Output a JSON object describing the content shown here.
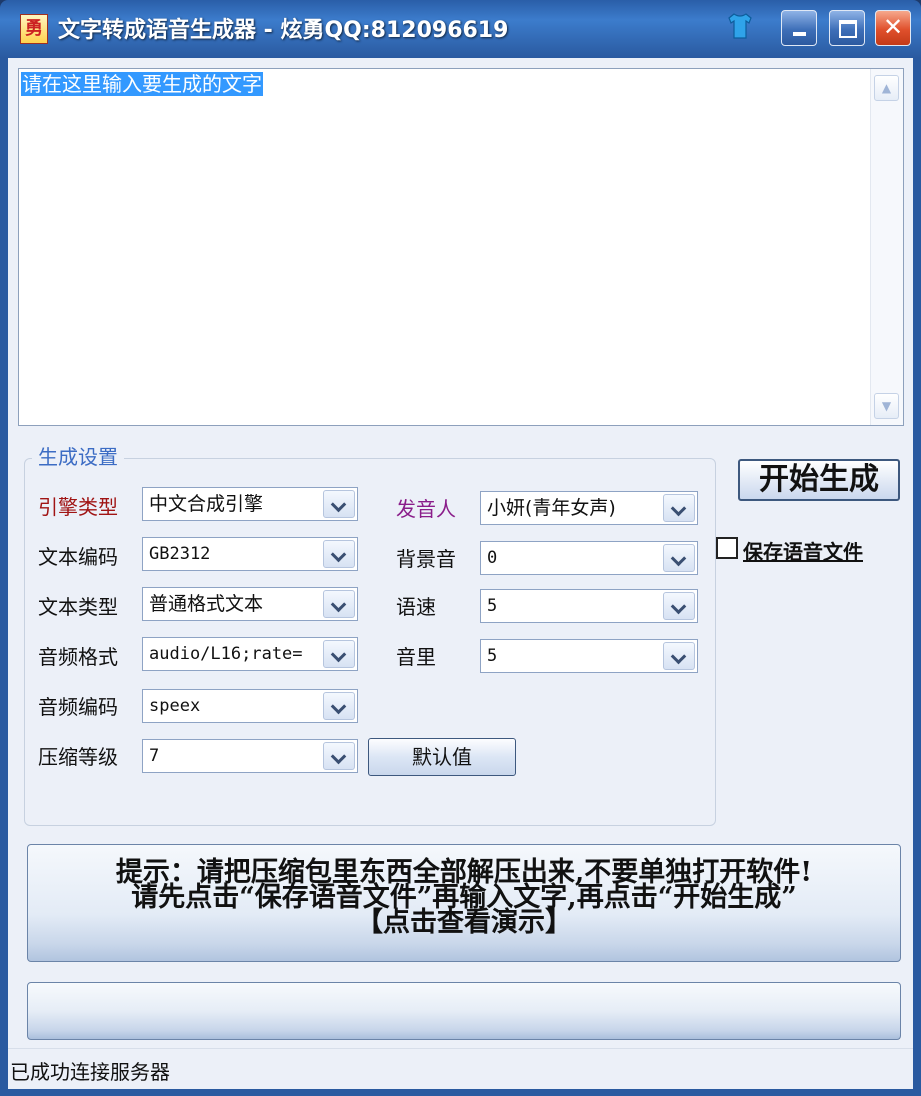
{
  "window": {
    "title": "文字转成语音生成器 - 炫勇QQ:812096619",
    "app_icon_char": "勇"
  },
  "input": {
    "text": "请在这里输入要生成的文字"
  },
  "settings": {
    "group_title": "生成设置",
    "engine": {
      "label": "引擎类型",
      "value": "中文合成引擎"
    },
    "encoding": {
      "label": "文本编码",
      "value": "GB2312"
    },
    "text_type": {
      "label": "文本类型",
      "value": "普通格式文本"
    },
    "audio_format": {
      "label": "音频格式",
      "value": "audio/L16;rate="
    },
    "audio_codec": {
      "label": "音频编码",
      "value": "speex"
    },
    "compression": {
      "label": "压缩等级",
      "value": "7"
    },
    "speaker": {
      "label": "发音人",
      "value": "小妍(青年女声)"
    },
    "background": {
      "label": "背景音",
      "value": "0"
    },
    "speed": {
      "label": "语速",
      "value": "5"
    },
    "volume": {
      "label": "音里",
      "value": "5"
    },
    "default_button": "默认值"
  },
  "actions": {
    "start_button": "开始生成",
    "save_checkbox_label": "保存语音文件",
    "save_checked": false
  },
  "tip": {
    "line1": "提示：请把压缩包里东西全部解压出来,不要单独打开软件!",
    "line2": "请先点击“保存语音文件”再输入文字,再点击“开始生成”",
    "line3": "【点击查看演示】"
  },
  "progress": {
    "value": 0
  },
  "status": {
    "text": "已成功连接服务器"
  },
  "colors": {
    "title_bar": "#3c7ccc",
    "client_bg": "#ecf0f8",
    "selection": "#3399ff",
    "label_red": "#a01414",
    "label_purple": "#8a1d8a",
    "group_title": "#3c6cc4",
    "close_button": "#e0502c"
  },
  "icons": [
    "app-icon",
    "shirt-icon",
    "minimize-icon",
    "maximize-icon",
    "close-icon",
    "chevron-down-icon",
    "scroll-up-icon",
    "scroll-down-icon"
  ]
}
